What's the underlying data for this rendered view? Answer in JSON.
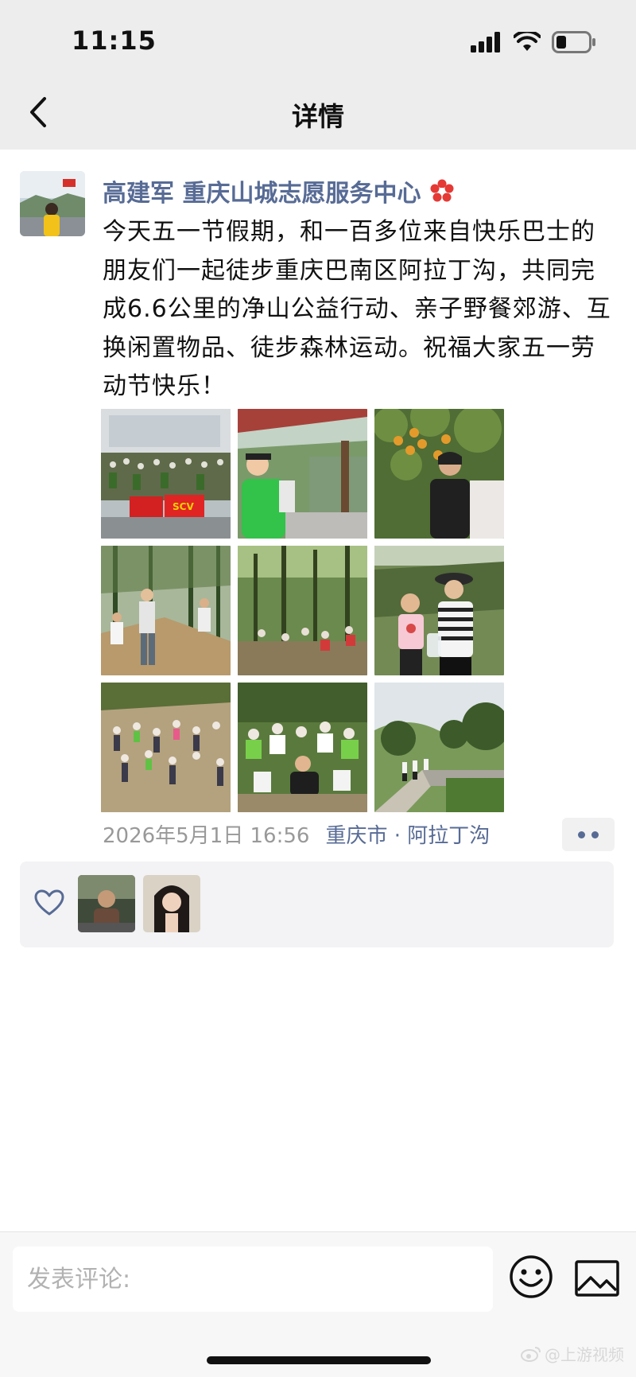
{
  "status_bar": {
    "time": "11:15"
  },
  "nav": {
    "title": "详情",
    "back_icon": "chevron-left-icon"
  },
  "post": {
    "author": "高建军 重庆山城志愿服务中心",
    "badge_icon": "red-flower-icon",
    "text": "今天五一节假期，和一百多位来自快乐巴士的朋友们一起徒步重庆巴南区阿拉丁沟，共同完成6.6公里的净山公益行动、亲子野餐郊游、互换闲置物品、徒步森林运动。祝福大家五一劳动节快乐！",
    "photos": [
      "group-photo-with-banners",
      "selfie-on-trail",
      "woman-with-loquat-tree",
      "hikers-on-forest-slope",
      "people-in-forest",
      "child-and-woman-in-striped-shirt",
      "crowd-on-hillside",
      "group-sitting-in-forest",
      "path-through-farmland"
    ],
    "banner_text": "SCV",
    "date": "2026年5月1日 16:56",
    "location": "重庆市 · 阿拉丁沟"
  },
  "likes": {
    "icon": "heart-outline-icon",
    "count_avatars": 2
  },
  "comment_bar": {
    "placeholder": "发表评论:",
    "emoji_icon": "smiley-icon",
    "image_icon": "image-icon"
  },
  "watermark": "@上游视频",
  "colors": {
    "link": "#576b95",
    "nav_bg": "#ededed",
    "meta": "#999999"
  }
}
